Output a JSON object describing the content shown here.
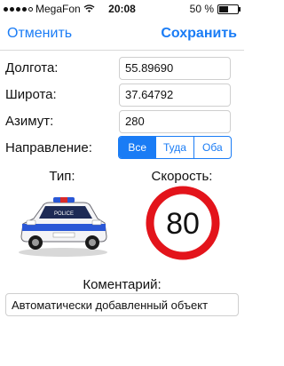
{
  "status_bar": {
    "carrier": "MegaFon",
    "time": "20:08",
    "battery_text": "50 %",
    "battery_level": 0.5,
    "signal_icon": "signal-dots-icon",
    "wifi_icon": "wifi-icon"
  },
  "nav": {
    "cancel_label": "Отменить",
    "save_label": "Сохранить"
  },
  "fields": {
    "longitude": {
      "label": "Долгота:",
      "value": "55.89690"
    },
    "latitude": {
      "label": "Широта:",
      "value": "37.64792"
    },
    "azimuth": {
      "label": "Азимут:",
      "value": "280"
    }
  },
  "direction": {
    "label": "Направление:",
    "options": [
      "Все",
      "Туда",
      "Оба"
    ],
    "selected": "Все"
  },
  "type": {
    "label": "Тип:",
    "icon": "police-car-icon",
    "car_text": "POLICE"
  },
  "speed": {
    "label": "Скорость:",
    "value": "80",
    "icon": "speed-limit-sign-icon"
  },
  "comment": {
    "label": "Коментарий:",
    "value": "Автоматически добавленный объект"
  },
  "colors": {
    "accent": "#1a7cf5",
    "sign_red": "#e3141b"
  }
}
